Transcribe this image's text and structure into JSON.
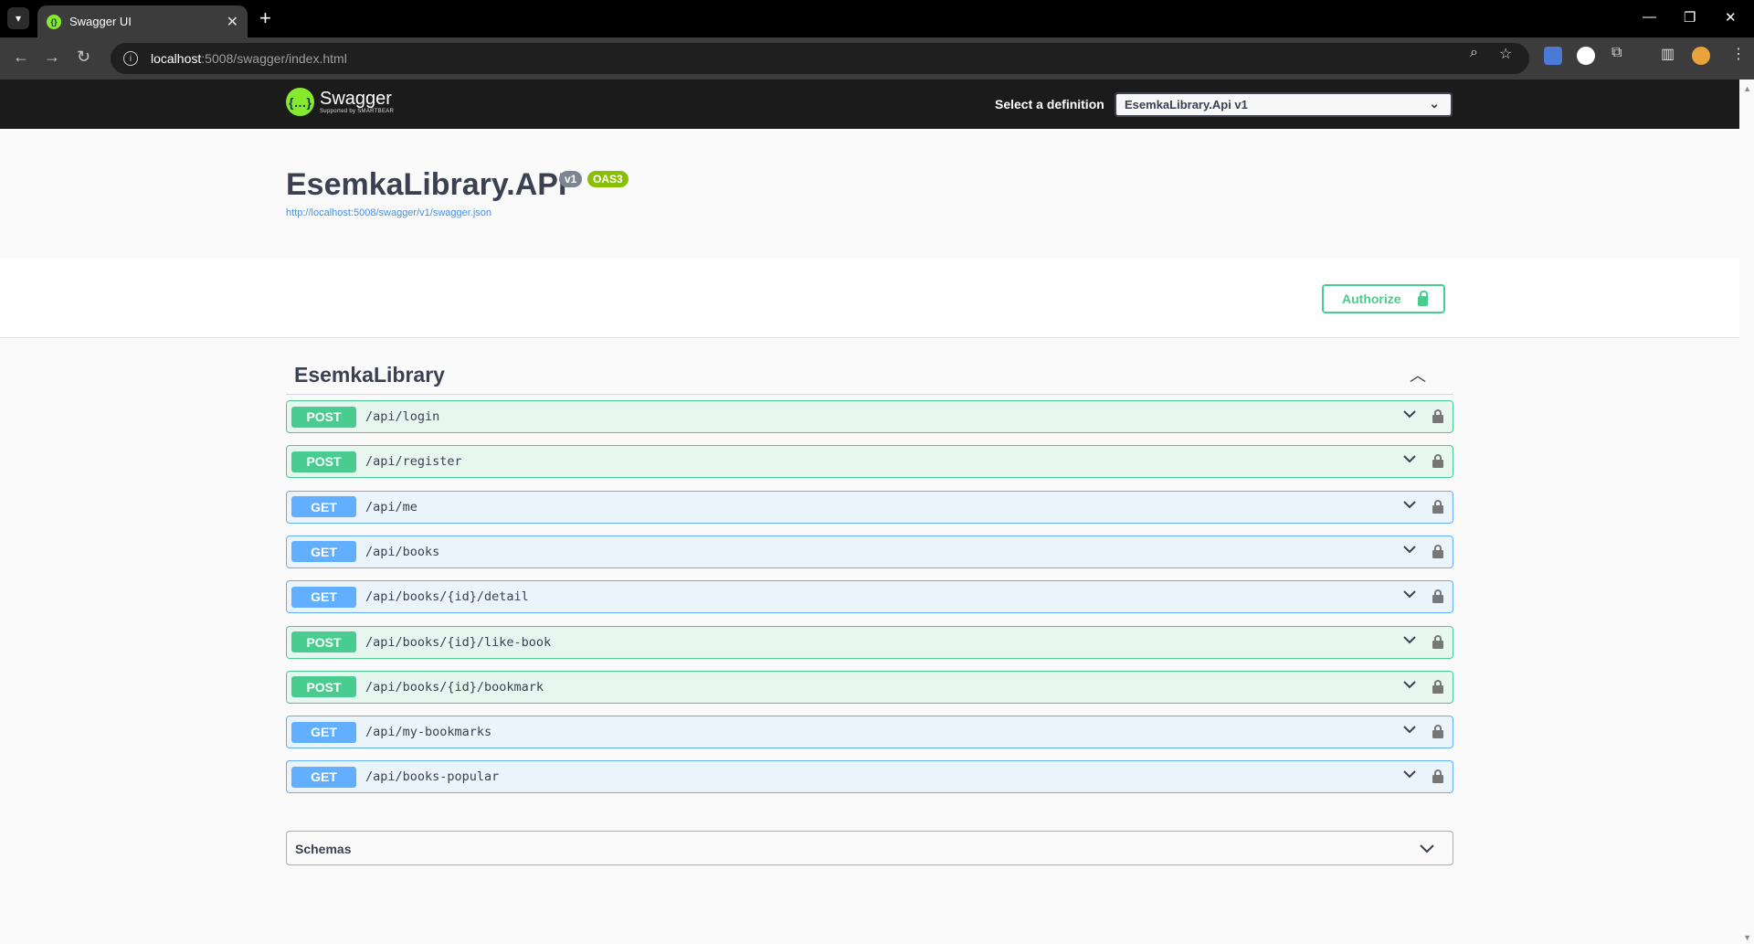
{
  "browser": {
    "tab_title": "Swagger UI",
    "url_host": "localhost",
    "url_rest": ":5008/swagger/index.html"
  },
  "topbar": {
    "logo_text": "Swagger",
    "logo_sub": "Supported by SMARTBEAR",
    "definition_label": "Select a definition",
    "definition_value": "EsemkaLibrary.Api v1"
  },
  "info": {
    "title": "EsemkaLibrary.API",
    "version_badge": "v1",
    "oas_badge": "OAS3",
    "spec_url": "http://localhost:5008/swagger/v1/swagger.json"
  },
  "authorize": {
    "label": "Authorize"
  },
  "tag": {
    "name": "EsemkaLibrary"
  },
  "operations": [
    {
      "method": "POST",
      "path": "/api/login"
    },
    {
      "method": "POST",
      "path": "/api/register"
    },
    {
      "method": "GET",
      "path": "/api/me"
    },
    {
      "method": "GET",
      "path": "/api/books"
    },
    {
      "method": "GET",
      "path": "/api/books/{id}/detail"
    },
    {
      "method": "POST",
      "path": "/api/books/{id}/like-book"
    },
    {
      "method": "POST",
      "path": "/api/books/{id}/bookmark"
    },
    {
      "method": "GET",
      "path": "/api/my-bookmarks"
    },
    {
      "method": "GET",
      "path": "/api/books-popular"
    }
  ],
  "schemas": {
    "title": "Schemas"
  },
  "colors": {
    "post": "#49cc90",
    "get": "#61affe",
    "swagger_green": "#85ea2d"
  }
}
